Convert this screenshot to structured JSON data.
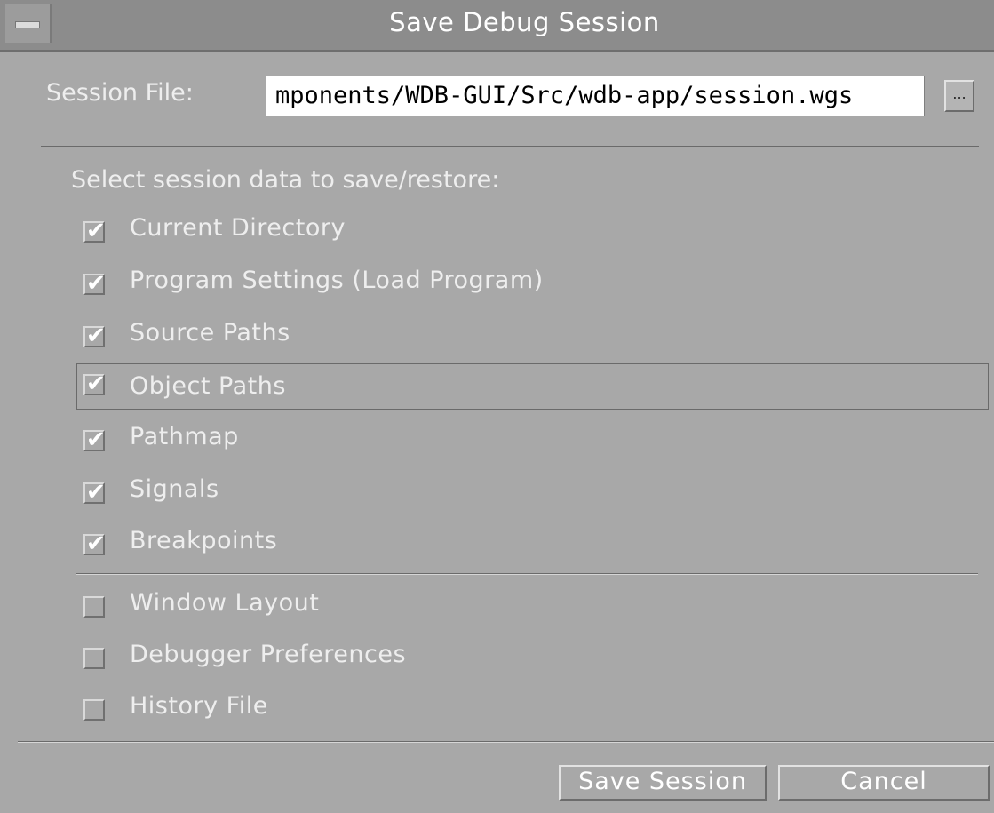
{
  "window": {
    "title": "Save Debug Session"
  },
  "session_file": {
    "label": "Session File:",
    "value": "mponents/WDB-GUI/Src/wdb-app/session.wgs",
    "browse_label": "..."
  },
  "section_label": "Select session data to save/restore:",
  "options": [
    {
      "label": "Current Directory",
      "checked": true
    },
    {
      "label": "Program Settings (Load Program)",
      "checked": true
    },
    {
      "label": "Source Paths",
      "checked": true
    },
    {
      "label": "Object Paths",
      "checked": true,
      "focused": true
    },
    {
      "label": "Pathmap",
      "checked": true
    },
    {
      "label": "Signals",
      "checked": true
    },
    {
      "label": "Breakpoints",
      "checked": true
    },
    {
      "label": "Window Layout",
      "checked": false
    },
    {
      "label": "Debugger Preferences",
      "checked": false
    },
    {
      "label": "History File",
      "checked": false
    }
  ],
  "check_glyph": "✔",
  "buttons": {
    "save": "Save Session",
    "cancel": "Cancel"
  }
}
